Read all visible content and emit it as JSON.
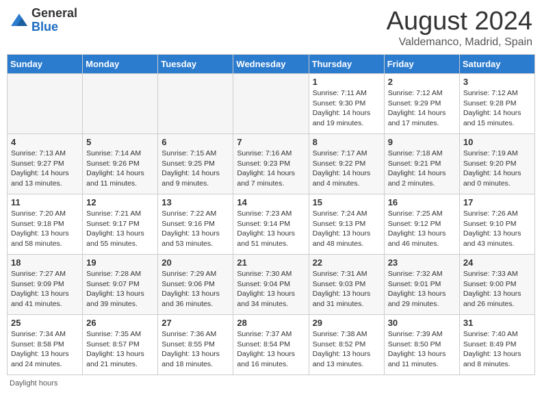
{
  "header": {
    "logo_general": "General",
    "logo_blue": "Blue",
    "month_title": "August 2024",
    "location": "Valdemanco, Madrid, Spain"
  },
  "days_of_week": [
    "Sunday",
    "Monday",
    "Tuesday",
    "Wednesday",
    "Thursday",
    "Friday",
    "Saturday"
  ],
  "footer": {
    "daylight_label": "Daylight hours"
  },
  "weeks": [
    {
      "days": [
        {
          "num": "",
          "info": "",
          "empty": true
        },
        {
          "num": "",
          "info": "",
          "empty": true
        },
        {
          "num": "",
          "info": "",
          "empty": true
        },
        {
          "num": "",
          "info": "",
          "empty": true
        },
        {
          "num": "1",
          "info": "Sunrise: 7:11 AM\nSunset: 9:30 PM\nDaylight: 14 hours\nand 19 minutes."
        },
        {
          "num": "2",
          "info": "Sunrise: 7:12 AM\nSunset: 9:29 PM\nDaylight: 14 hours\nand 17 minutes."
        },
        {
          "num": "3",
          "info": "Sunrise: 7:12 AM\nSunset: 9:28 PM\nDaylight: 14 hours\nand 15 minutes."
        }
      ]
    },
    {
      "days": [
        {
          "num": "4",
          "info": "Sunrise: 7:13 AM\nSunset: 9:27 PM\nDaylight: 14 hours\nand 13 minutes."
        },
        {
          "num": "5",
          "info": "Sunrise: 7:14 AM\nSunset: 9:26 PM\nDaylight: 14 hours\nand 11 minutes."
        },
        {
          "num": "6",
          "info": "Sunrise: 7:15 AM\nSunset: 9:25 PM\nDaylight: 14 hours\nand 9 minutes."
        },
        {
          "num": "7",
          "info": "Sunrise: 7:16 AM\nSunset: 9:23 PM\nDaylight: 14 hours\nand 7 minutes."
        },
        {
          "num": "8",
          "info": "Sunrise: 7:17 AM\nSunset: 9:22 PM\nDaylight: 14 hours\nand 4 minutes."
        },
        {
          "num": "9",
          "info": "Sunrise: 7:18 AM\nSunset: 9:21 PM\nDaylight: 14 hours\nand 2 minutes."
        },
        {
          "num": "10",
          "info": "Sunrise: 7:19 AM\nSunset: 9:20 PM\nDaylight: 14 hours\nand 0 minutes."
        }
      ]
    },
    {
      "days": [
        {
          "num": "11",
          "info": "Sunrise: 7:20 AM\nSunset: 9:18 PM\nDaylight: 13 hours\nand 58 minutes."
        },
        {
          "num": "12",
          "info": "Sunrise: 7:21 AM\nSunset: 9:17 PM\nDaylight: 13 hours\nand 55 minutes."
        },
        {
          "num": "13",
          "info": "Sunrise: 7:22 AM\nSunset: 9:16 PM\nDaylight: 13 hours\nand 53 minutes."
        },
        {
          "num": "14",
          "info": "Sunrise: 7:23 AM\nSunset: 9:14 PM\nDaylight: 13 hours\nand 51 minutes."
        },
        {
          "num": "15",
          "info": "Sunrise: 7:24 AM\nSunset: 9:13 PM\nDaylight: 13 hours\nand 48 minutes."
        },
        {
          "num": "16",
          "info": "Sunrise: 7:25 AM\nSunset: 9:12 PM\nDaylight: 13 hours\nand 46 minutes."
        },
        {
          "num": "17",
          "info": "Sunrise: 7:26 AM\nSunset: 9:10 PM\nDaylight: 13 hours\nand 43 minutes."
        }
      ]
    },
    {
      "days": [
        {
          "num": "18",
          "info": "Sunrise: 7:27 AM\nSunset: 9:09 PM\nDaylight: 13 hours\nand 41 minutes."
        },
        {
          "num": "19",
          "info": "Sunrise: 7:28 AM\nSunset: 9:07 PM\nDaylight: 13 hours\nand 39 minutes."
        },
        {
          "num": "20",
          "info": "Sunrise: 7:29 AM\nSunset: 9:06 PM\nDaylight: 13 hours\nand 36 minutes."
        },
        {
          "num": "21",
          "info": "Sunrise: 7:30 AM\nSunset: 9:04 PM\nDaylight: 13 hours\nand 34 minutes."
        },
        {
          "num": "22",
          "info": "Sunrise: 7:31 AM\nSunset: 9:03 PM\nDaylight: 13 hours\nand 31 minutes."
        },
        {
          "num": "23",
          "info": "Sunrise: 7:32 AM\nSunset: 9:01 PM\nDaylight: 13 hours\nand 29 minutes."
        },
        {
          "num": "24",
          "info": "Sunrise: 7:33 AM\nSunset: 9:00 PM\nDaylight: 13 hours\nand 26 minutes."
        }
      ]
    },
    {
      "days": [
        {
          "num": "25",
          "info": "Sunrise: 7:34 AM\nSunset: 8:58 PM\nDaylight: 13 hours\nand 24 minutes."
        },
        {
          "num": "26",
          "info": "Sunrise: 7:35 AM\nSunset: 8:57 PM\nDaylight: 13 hours\nand 21 minutes."
        },
        {
          "num": "27",
          "info": "Sunrise: 7:36 AM\nSunset: 8:55 PM\nDaylight: 13 hours\nand 18 minutes."
        },
        {
          "num": "28",
          "info": "Sunrise: 7:37 AM\nSunset: 8:54 PM\nDaylight: 13 hours\nand 16 minutes."
        },
        {
          "num": "29",
          "info": "Sunrise: 7:38 AM\nSunset: 8:52 PM\nDaylight: 13 hours\nand 13 minutes."
        },
        {
          "num": "30",
          "info": "Sunrise: 7:39 AM\nSunset: 8:50 PM\nDaylight: 13 hours\nand 11 minutes."
        },
        {
          "num": "31",
          "info": "Sunrise: 7:40 AM\nSunset: 8:49 PM\nDaylight: 13 hours\nand 8 minutes."
        }
      ]
    }
  ]
}
